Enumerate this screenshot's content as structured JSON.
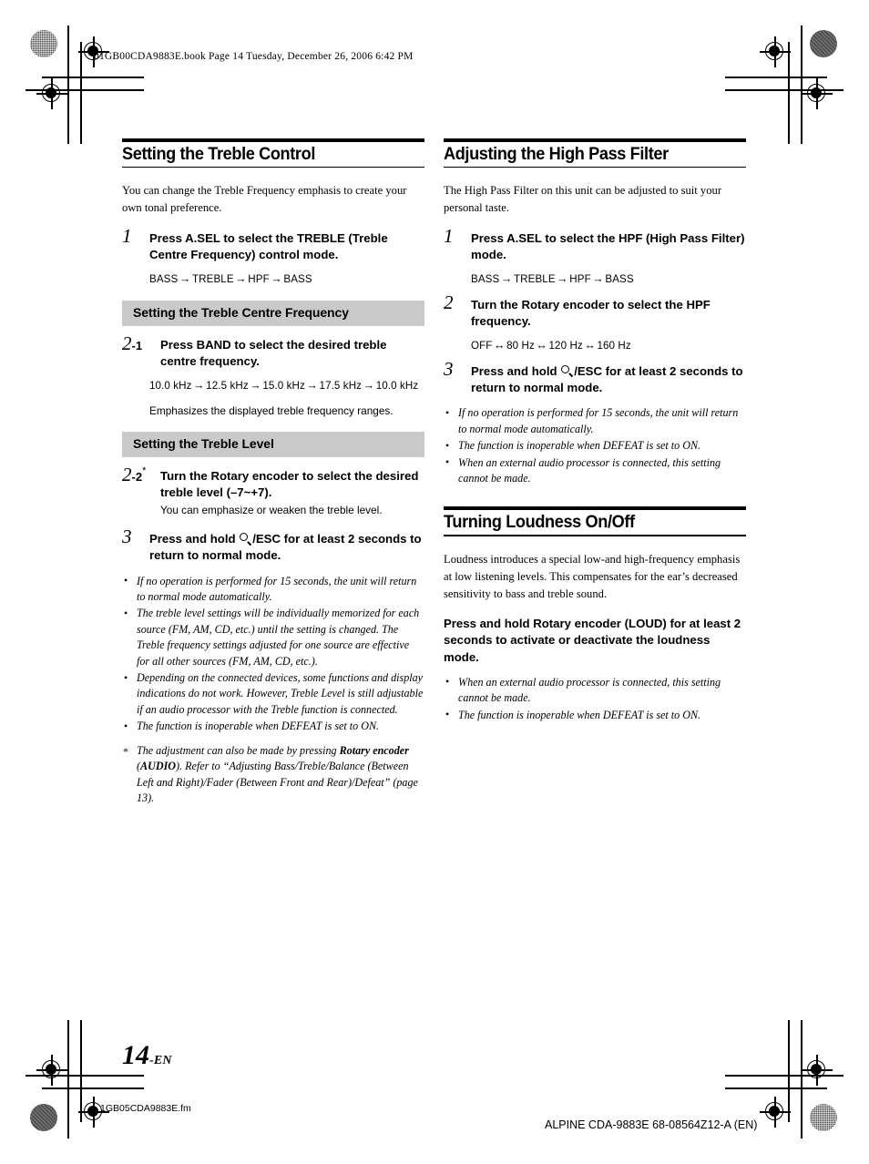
{
  "page": {
    "running_head": "01GB00CDA9883E.book  Page 14  Tuesday, December 26, 2006  6:42 PM",
    "page_number": "14",
    "page_number_suffix": "-EN",
    "footer_left": "1GB05CDA9883E.fm",
    "footer_right": "ALPINE CDA-9883E 68-08564Z12-A (EN)"
  },
  "left_column": {
    "section": {
      "title": "Setting the Treble Control",
      "intro": "You can change the Treble Frequency emphasis to create your own tonal preference.",
      "step1": {
        "number": "1",
        "text_pre": "Press ",
        "text_bold": "A.SEL",
        "text_post": " to select the TREBLE (Treble Centre Frequency) control mode.",
        "sequence": [
          "BASS",
          "TREBLE",
          "HPF",
          "BASS"
        ],
        "arrow": "→"
      }
    },
    "subsection_freq": {
      "title": "Setting the Treble Centre Frequency",
      "step": {
        "number": "2",
        "suffix": "-1",
        "text_pre": "Press ",
        "text_bold": "BAND",
        "text_post": " to select the desired treble centre frequency.",
        "sequence": [
          "10.0 kHz",
          "12.5 kHz",
          "15.0 kHz",
          "17.5 kHz",
          "10.0 kHz"
        ],
        "arrow": "→",
        "note": "Emphasizes the displayed treble frequency ranges."
      }
    },
    "subsection_level": {
      "title": "Setting the Treble Level",
      "step": {
        "number": "2",
        "suffix": "-2",
        "star": "*",
        "text_pre": "Turn the ",
        "text_bold": "Rotary encoder",
        "text_post": " to select the desired treble level (–7~+7).",
        "note": "You can emphasize or weaken the treble level."
      }
    },
    "step3": {
      "number": "3",
      "text_pre": "Press and hold ",
      "icon": "magnifier-icon",
      "text_bold": "/ESC",
      "text_post": " for at least 2 seconds to return to normal mode."
    },
    "notes": [
      "If no operation is performed for 15 seconds, the unit will return to normal mode automatically.",
      "The treble level settings will be individually memorized for each source (FM, AM, CD, etc.) until the setting is changed. The Treble frequency settings adjusted for one source are effective for all other sources (FM, AM, CD, etc.).",
      "Depending on the connected devices, some functions and display indications do not work. However, Treble Level is still adjustable if an audio processor with the Treble function is connected.",
      "The function is inoperable when DEFEAT is set to ON."
    ],
    "footnote": {
      "part1": "The adjustment can also be made by pressing ",
      "bold1": "Rotary encoder",
      "part2": " (",
      "bold2": "AUDIO",
      "part3": "). Refer to “Adjusting Bass/Treble/Balance (Between Left and Right)/Fader (Between Front and Rear)/Defeat” (page 13)."
    }
  },
  "right_column": {
    "section_hpf": {
      "title": "Adjusting the High Pass Filter",
      "intro": "The High Pass Filter on this unit can be adjusted to suit your personal taste.",
      "step1": {
        "number": "1",
        "text_pre": "Press ",
        "text_bold": "A.SEL",
        "text_post": " to select the HPF (High Pass Filter) mode.",
        "sequence": [
          "BASS",
          "TREBLE",
          "HPF",
          "BASS"
        ],
        "arrow": "→"
      },
      "step2": {
        "number": "2",
        "text_pre": "Turn the ",
        "text_bold": "Rotary encoder",
        "text_post": " to select the HPF frequency.",
        "sequence": [
          "OFF",
          "80 Hz",
          "120 Hz",
          "160 Hz"
        ],
        "arrow": "↔"
      },
      "step3": {
        "number": "3",
        "text_pre": "Press and hold ",
        "icon": "magnifier-icon",
        "text_bold": "/ESC",
        "text_post": " for at least 2 seconds to return to normal mode."
      },
      "notes": [
        "If no operation is performed for 15 seconds, the unit will return to normal mode automatically.",
        "The function is inoperable when DEFEAT is set to ON.",
        "When an external audio processor is connected, this setting cannot be made."
      ]
    },
    "section_loudness": {
      "title": "Turning Loudness On/Off",
      "intro": "Loudness introduces a special low-and high-frequency emphasis at low listening levels. This compensates for the ear’s decreased sensitivity to bass and treble sound.",
      "instruction": {
        "text_pre": "Press and hold ",
        "bold1": "Rotary encoder",
        "mid": " (",
        "bold2": "LOUD",
        "text_post": ") for at least 2 seconds to activate or deactivate the loudness mode."
      },
      "notes": [
        "When an external audio processor is connected, this setting cannot be made.",
        "The function is inoperable when DEFEAT is set to ON."
      ]
    }
  },
  "colors": {
    "subheading_bar": "#c9c9c9",
    "rule": "#000000",
    "text": "#000000"
  }
}
